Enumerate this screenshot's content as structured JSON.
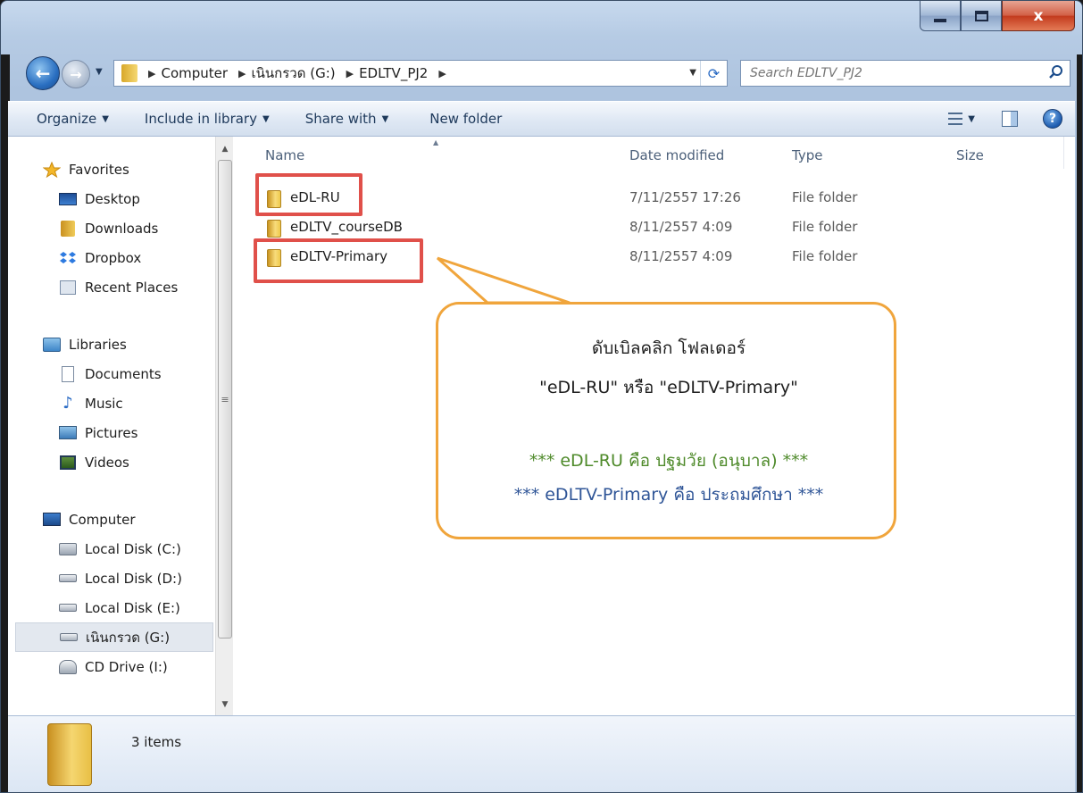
{
  "window": {
    "buttons": {
      "close_label": "x"
    }
  },
  "address_bar": {
    "crumbs": [
      "Computer",
      "เนินกรวด (G:)",
      "EDLTV_PJ2"
    ]
  },
  "search": {
    "placeholder": "Search EDLTV_PJ2"
  },
  "toolbar": {
    "organize": "Organize",
    "include_in_library": "Include in library",
    "share_with": "Share with",
    "new_folder": "New folder"
  },
  "nav": {
    "favorites": {
      "label": "Favorites",
      "items": [
        "Desktop",
        "Downloads",
        "Dropbox",
        "Recent Places"
      ]
    },
    "libraries": {
      "label": "Libraries",
      "items": [
        "Documents",
        "Music",
        "Pictures",
        "Videos"
      ]
    },
    "computer": {
      "label": "Computer",
      "items": [
        "Local Disk (C:)",
        "Local Disk (D:)",
        "Local Disk (E:)",
        "เนินกรวด (G:)",
        "CD Drive (I:)"
      ],
      "selected": "เนินกรวด (G:)"
    }
  },
  "columns": [
    "Name",
    "Date modified",
    "Type",
    "Size"
  ],
  "files": [
    {
      "name": "eDL-RU",
      "date": "7/11/2557 17:26",
      "type": "File folder"
    },
    {
      "name": "eDLTV_courseDB",
      "date": "8/11/2557 4:09",
      "type": "File folder"
    },
    {
      "name": "eDLTV-Primary",
      "date": "8/11/2557 4:09",
      "type": "File folder"
    }
  ],
  "callout": {
    "line1": "ดับเบิลคลิก โฟลเดอร์",
    "line2": "\"eDL-RU\" หรือ \"eDLTV-Primary\"",
    "line3": "*** eDL-RU คือ ปฐมวัย (อนุบาล) ***",
    "line4": "*** eDLTV-Primary คือ ประถมศึกษา ***",
    "colors": {
      "border": "#f0a53c",
      "line3": "#4e8a2a",
      "line4": "#2f5597",
      "highlight_box": "#e0504a"
    }
  },
  "status": {
    "count": "3 items"
  }
}
